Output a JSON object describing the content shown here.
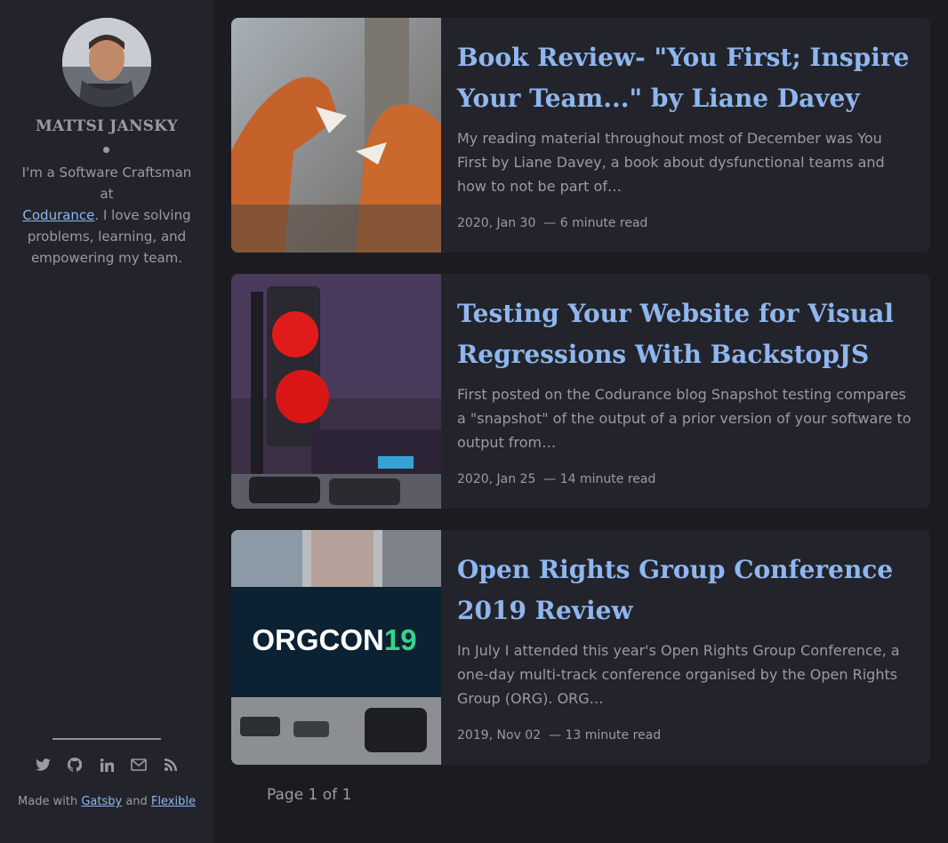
{
  "sidebar": {
    "author_name": "MATTSI JANSKY",
    "bio_prefix": "I'm a Software Craftsman at",
    "bio_link": "Codurance",
    "bio_suffix": ". I love solving problems, learning, and empowering my team.",
    "social_icons": [
      "twitter-icon",
      "github-icon",
      "linkedin-icon",
      "email-icon",
      "rss-icon"
    ],
    "made_prefix": "Made with",
    "made_link1": "Gatsby",
    "made_mid": "and",
    "made_link2": "Flexible"
  },
  "posts": [
    {
      "title": "Book Review- \"You First; Inspire Your Team...\" by Liane Davey",
      "excerpt": "My reading material throughout most of December was You First by Liane Davey, a book about dysfunctional teams and how to not be part of…",
      "date": "2020, Jan 30",
      "read_time": "6 minute read",
      "image": "foxes-photo"
    },
    {
      "title": "Testing Your Website for Visual Regressions With BackstopJS",
      "excerpt": "First posted on the Codurance blog Snapshot testing compares a \"snapshot\" of the output of a prior version of your software to output from…",
      "date": "2020, Jan 25",
      "read_time": "14 minute read",
      "image": "traffic-light-photo"
    },
    {
      "title": "Open Rights Group Conference 2019 Review",
      "excerpt": "In July I attended this year's Open Rights Group Conference, a one-day multi-track conference organised by the Open Rights Group (ORG). ORG…",
      "date": "2019, Nov 02",
      "read_time": "13 minute read",
      "image": "orgcon-photo",
      "image_text_a": "ORGCON",
      "image_text_b": "19"
    }
  ],
  "pagination": {
    "label": "Page 1 of 1"
  },
  "colors": {
    "background": "#1b1c21",
    "card": "#23242b",
    "link": "#8fb6ef",
    "text": "#9a9ba2"
  }
}
